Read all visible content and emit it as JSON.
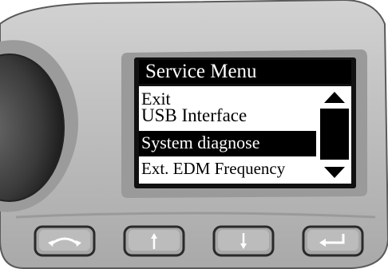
{
  "screen": {
    "title": "Service Menu",
    "menu_items": [
      {
        "label": "Exit",
        "selected": false
      },
      {
        "label": "USB Interface",
        "selected": false
      },
      {
        "label": "System diagnose",
        "selected": true
      },
      {
        "label": "Ext. EDM Frequency",
        "selected": false
      }
    ],
    "scroll_up_icon": "triangle-up-icon",
    "scroll_down_icon": "triangle-down-icon"
  },
  "keys": [
    {
      "icon": "back-arc-icon"
    },
    {
      "icon": "arrow-up-icon"
    },
    {
      "icon": "arrow-down-icon"
    },
    {
      "icon": "enter-icon"
    }
  ],
  "colors": {
    "bezel": "#b9b9b9",
    "bezel_dark": "#8e8e8e",
    "screen_frame": "#111111",
    "highlight": "#000000"
  }
}
